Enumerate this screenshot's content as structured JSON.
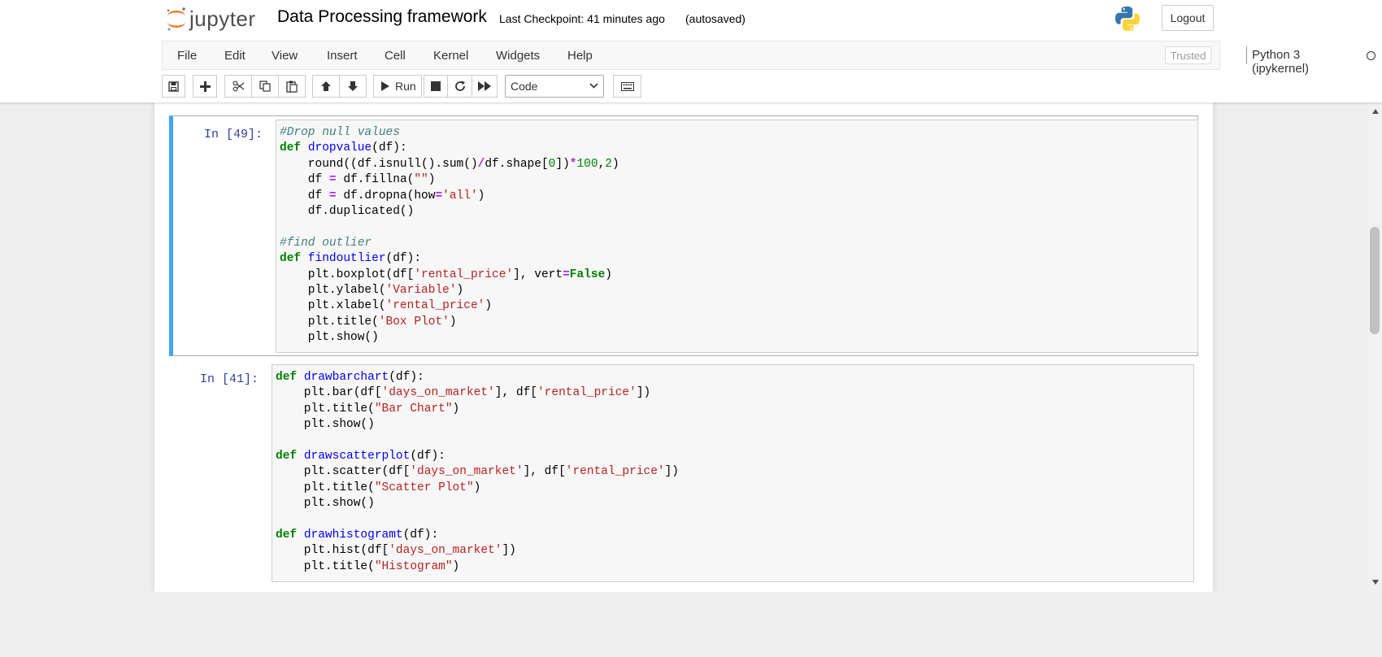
{
  "header": {
    "logo_text": "jupyter",
    "notebook_title": "Data Processing framework",
    "checkpoint": "Last Checkpoint: 41 minutes ago",
    "autosave": "(autosaved)",
    "logout_label": "Logout"
  },
  "menubar": {
    "items": [
      "File",
      "Edit",
      "View",
      "Insert",
      "Cell",
      "Kernel",
      "Widgets",
      "Help"
    ],
    "trusted_label": "Trusted",
    "kernel_name": "Python 3 (ipykernel)"
  },
  "toolbar": {
    "run_label": "Run",
    "cell_type": "Code",
    "icons": [
      "save-icon",
      "plus-icon",
      "scissors-icon",
      "copy-icon",
      "paste-icon",
      "arrow-up-icon",
      "arrow-down-icon",
      "run-icon",
      "stop-icon",
      "restart-icon",
      "fast-forward-icon",
      "keyboard-icon"
    ]
  },
  "cells": [
    {
      "prompt": "In [49]:",
      "selected": true,
      "lines": [
        [
          [
            "cm",
            "#Drop null values"
          ]
        ],
        [
          [
            "kw",
            "def"
          ],
          [
            "plain",
            " "
          ],
          [
            "fn",
            "dropvalue"
          ],
          [
            "plain",
            "(df):"
          ]
        ],
        [
          [
            "plain",
            "    round((df.isnull().sum()"
          ],
          [
            "op",
            "/"
          ],
          [
            "plain",
            "df.shape["
          ],
          [
            "nu",
            "0"
          ],
          [
            "plain",
            "])"
          ],
          [
            "op",
            "*"
          ],
          [
            "nu",
            "100"
          ],
          [
            "plain",
            ","
          ],
          [
            "nu",
            "2"
          ],
          [
            "plain",
            ")"
          ]
        ],
        [
          [
            "plain",
            "    df "
          ],
          [
            "op",
            "="
          ],
          [
            "plain",
            " df.fillna("
          ],
          [
            "st",
            "\"\""
          ],
          [
            "plain",
            ")"
          ]
        ],
        [
          [
            "plain",
            "    df "
          ],
          [
            "op",
            "="
          ],
          [
            "plain",
            " df.dropna(how"
          ],
          [
            "op",
            "="
          ],
          [
            "st",
            "'all'"
          ],
          [
            "plain",
            ")"
          ]
        ],
        [
          [
            "plain",
            "    df.duplicated()"
          ]
        ],
        [
          [
            "plain",
            ""
          ]
        ],
        [
          [
            "cm",
            "#find outlier"
          ]
        ],
        [
          [
            "kw",
            "def"
          ],
          [
            "plain",
            " "
          ],
          [
            "fn",
            "findoutlier"
          ],
          [
            "plain",
            "(df):"
          ]
        ],
        [
          [
            "plain",
            "    plt.boxplot(df["
          ],
          [
            "st",
            "'rental_price'"
          ],
          [
            "plain",
            "], vert"
          ],
          [
            "op",
            "="
          ],
          [
            "kw",
            "False"
          ],
          [
            "plain",
            ")"
          ]
        ],
        [
          [
            "plain",
            "    plt.ylabel("
          ],
          [
            "st",
            "'Variable'"
          ],
          [
            "plain",
            ")"
          ]
        ],
        [
          [
            "plain",
            "    plt.xlabel("
          ],
          [
            "st",
            "'rental_price'"
          ],
          [
            "plain",
            ")"
          ]
        ],
        [
          [
            "plain",
            "    plt.title("
          ],
          [
            "st",
            "'Box Plot'"
          ],
          [
            "plain",
            ")"
          ]
        ],
        [
          [
            "plain",
            "    plt.show()"
          ]
        ]
      ]
    },
    {
      "prompt": "In [41]:",
      "selected": false,
      "lines": [
        [
          [
            "kw",
            "def"
          ],
          [
            "plain",
            " "
          ],
          [
            "fn",
            "drawbarchart"
          ],
          [
            "plain",
            "(df):"
          ]
        ],
        [
          [
            "plain",
            "    plt.bar(df["
          ],
          [
            "st",
            "'days_on_market'"
          ],
          [
            "plain",
            "], df["
          ],
          [
            "st",
            "'rental_price'"
          ],
          [
            "plain",
            "])"
          ]
        ],
        [
          [
            "plain",
            "    plt.title("
          ],
          [
            "st",
            "\"Bar Chart\""
          ],
          [
            "plain",
            ")"
          ]
        ],
        [
          [
            "plain",
            "    plt.show()"
          ]
        ],
        [
          [
            "plain",
            ""
          ]
        ],
        [
          [
            "kw",
            "def"
          ],
          [
            "plain",
            " "
          ],
          [
            "fn",
            "drawscatterplot"
          ],
          [
            "plain",
            "(df):"
          ]
        ],
        [
          [
            "plain",
            "    plt.scatter(df["
          ],
          [
            "st",
            "'days_on_market'"
          ],
          [
            "plain",
            "], df["
          ],
          [
            "st",
            "'rental_price'"
          ],
          [
            "plain",
            "])"
          ]
        ],
        [
          [
            "plain",
            "    plt.title("
          ],
          [
            "st",
            "\"Scatter Plot\""
          ],
          [
            "plain",
            ")"
          ]
        ],
        [
          [
            "plain",
            "    plt.show()"
          ]
        ],
        [
          [
            "plain",
            ""
          ]
        ],
        [
          [
            "kw",
            "def"
          ],
          [
            "plain",
            " "
          ],
          [
            "fn",
            "drawhistogramt"
          ],
          [
            "plain",
            "(df):"
          ]
        ],
        [
          [
            "plain",
            "    plt.hist(df["
          ],
          [
            "st",
            "'days_on_market'"
          ],
          [
            "plain",
            "])"
          ]
        ],
        [
          [
            "plain",
            "    plt.title("
          ],
          [
            "st",
            "\"Histogram\""
          ],
          [
            "plain",
            ")"
          ]
        ]
      ]
    }
  ],
  "colors": {
    "selected_border": "#42a5f5",
    "prompt": "#303f9f",
    "keyword": "#008000",
    "string": "#ba2121",
    "comment": "#408080",
    "function": "#0000ff",
    "operator": "#aa22ff"
  }
}
